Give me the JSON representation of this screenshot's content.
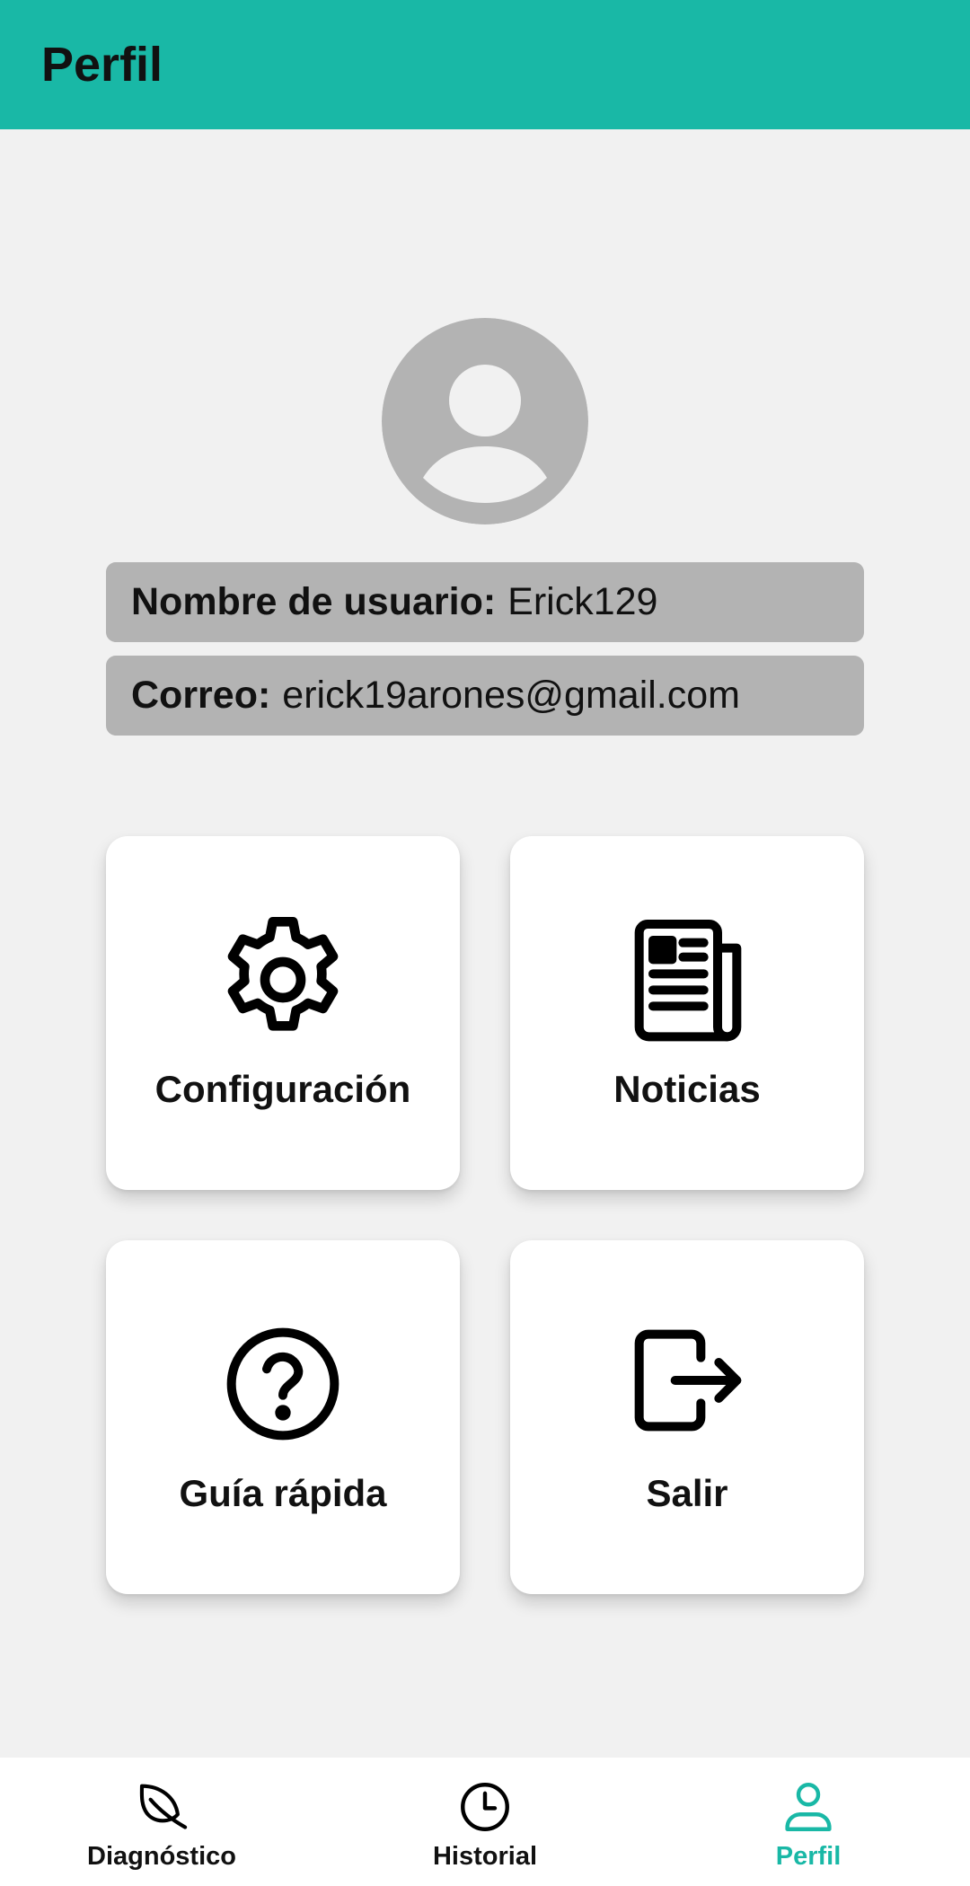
{
  "colors": {
    "accent": "#19b8a6",
    "avatar": "#b3b3b3"
  },
  "header": {
    "title": "Perfil"
  },
  "profile": {
    "username_label": "Nombre de usuario:",
    "username_value": "Erick129",
    "email_label": "Correo:",
    "email_value": "erick19arones@gmail.com"
  },
  "cards": [
    {
      "label": "Configuración",
      "icon": "gear-icon"
    },
    {
      "label": "Noticias",
      "icon": "newspaper-icon"
    },
    {
      "label": "Guía rápida",
      "icon": "help-circle-icon"
    },
    {
      "label": "Salir",
      "icon": "logout-icon"
    }
  ],
  "bottom_nav": {
    "active": "Perfil",
    "items": [
      {
        "label": "Diagnóstico",
        "icon": "leaf-icon"
      },
      {
        "label": "Historial",
        "icon": "clock-icon"
      },
      {
        "label": "Perfil",
        "icon": "person-icon"
      }
    ]
  }
}
